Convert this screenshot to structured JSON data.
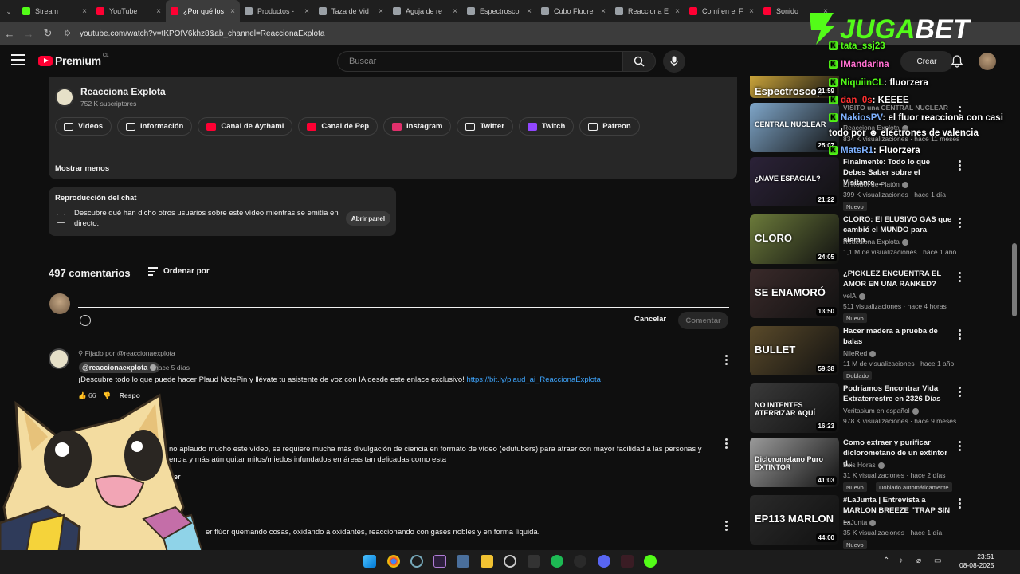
{
  "browser": {
    "tabs": [
      {
        "title": "Stream",
        "color": "#53fc18",
        "active": false
      },
      {
        "title": "YouTube",
        "color": "#ff0033",
        "active": false
      },
      {
        "title": "¿Por qué los",
        "color": "#ff0033",
        "active": true
      },
      {
        "title": "Productos -",
        "color": "#9aa0a6",
        "active": false
      },
      {
        "title": "Taza de Vid",
        "color": "#9aa0a6",
        "active": false
      },
      {
        "title": "Aguja de re",
        "color": "#9aa0a6",
        "active": false
      },
      {
        "title": "Espectrosco",
        "color": "#9aa0a6",
        "active": false
      },
      {
        "title": "Cubo Fluore",
        "color": "#9aa0a6",
        "active": false
      },
      {
        "title": "Reacciona E",
        "color": "#9aa0a6",
        "active": false
      },
      {
        "title": "Comí en el F",
        "color": "#ff0033",
        "active": false
      },
      {
        "title": "Sonido",
        "color": "#ff0033",
        "active": false
      }
    ],
    "url": "youtube.com/watch?v=tKPOfV6khz8&ab_channel=ReaccionaExplota"
  },
  "header": {
    "logo_text": "Premium",
    "logo_country": "CL",
    "search_placeholder": "Buscar",
    "create_label": "Crear"
  },
  "channel": {
    "name": "Reacciona Explota",
    "subscribers": "752 K suscriptores",
    "links": [
      {
        "label": "Videos",
        "icon": "video-icon",
        "color": "#f1f1f1"
      },
      {
        "label": "Información",
        "icon": "info-icon",
        "color": "#f1f1f1"
      },
      {
        "label": "Canal de Aythami",
        "icon": "youtube-icon",
        "color": "#ff0033"
      },
      {
        "label": "Canal de Pep",
        "icon": "youtube-icon",
        "color": "#ff0033"
      },
      {
        "label": "Instagram",
        "icon": "instagram-icon",
        "color": "#e1306c"
      },
      {
        "label": "Twitter",
        "icon": "x-icon",
        "color": "#f1f1f1"
      },
      {
        "label": "Twitch",
        "icon": "twitch-icon",
        "color": "#9146ff"
      },
      {
        "label": "Patreon",
        "icon": "patreon-icon",
        "color": "#f1f1f1"
      }
    ],
    "show_less": "Mostrar menos"
  },
  "chat_replay": {
    "title": "Reproducción del chat",
    "description": "Descubre qué han dicho otros usuarios sobre este vídeo mientras se emitía en directo.",
    "button": "Abrir panel"
  },
  "comments": {
    "count": "497 comentarios",
    "sort_label": "Ordenar por",
    "cancel": "Cancelar",
    "submit": "Comentar",
    "pinned": {
      "pinned_by": "Fijado por @reaccionaexplota",
      "author": "@reaccionaexplota",
      "time": "hace 5 días",
      "text": "¡Descubre todo lo que puede hacer Plaud NotePin y llévate tu asistente de voz con IA desde este enlace exclusivo! ",
      "link": "https://bit.ly/plaud_ai_ReaccionaExplota",
      "likes": "66",
      "reply": "Respo"
    },
    "second": {
      "text_line1": "no aplaudo mucho este vídeo, se requiere mucha más divulgación de ciencia en formato de vídeo (edutubers) para atraer con mayor facilidad a las personas y",
      "text_line2": "encia y más aún quitar mitos/miedos infundados en áreas tan delicadas como esta",
      "reply": "er"
    },
    "third": {
      "text": "er flúor quemando cosas, oxidando a oxidantes, reaccionando con gases nobles y en forma líquida."
    }
  },
  "sidebar": {
    "videos": [
      {
        "title": "",
        "channel": "",
        "stats": "",
        "duration": "21:59",
        "thumb_text": "Espectroscop",
        "thumb_color": "#c9a33a",
        "badges": []
      },
      {
        "title": "VISITO una CENTRAL NUCLEAR",
        "channel": "Reacciona Explota",
        "stats": "834 K visualizaciones · hace 11 meses",
        "duration": "25:07",
        "thumb_text": "CENTRAL NUCLEAR",
        "thumb_color": "#7fa6c9",
        "badges": []
      },
      {
        "title": "Finalmente: Todo lo que Debes Saber sobre el Visitante ...",
        "channel": "El Robot de Platón",
        "stats": "399 K visualizaciones · hace 1 día",
        "duration": "21:22",
        "thumb_text": "¿NAVE ESPACIAL?",
        "thumb_color": "#2b2238",
        "badges": [
          "Nuevo"
        ]
      },
      {
        "title": "CLORO: El ELUSIVO GAS que cambió el MUNDO para siemp...",
        "channel": "Reacciona Explota",
        "stats": "1,1 M de visualizaciones · hace 1 año",
        "duration": "24:05",
        "thumb_text": "CLORO",
        "thumb_color": "#6b7a3a",
        "badges": []
      },
      {
        "title": "¿PICKLEZ ENCUENTRA EL AMOR EN UNA RANKED?",
        "channel": "velA",
        "stats": "511 visualizaciones · hace 4 horas",
        "duration": "13:50",
        "thumb_text": "SE ENAMORÓ",
        "thumb_color": "#3a2a2a",
        "badges": [
          "Nuevo"
        ]
      },
      {
        "title": "Hacer madera a prueba de balas",
        "channel": "NileRed",
        "stats": "11 M de visualizaciones · hace 1 año",
        "duration": "59:38",
        "thumb_text": "BULLET",
        "thumb_color": "#5a4a2a",
        "badges": [
          "Doblado"
        ]
      },
      {
        "title": "Podríamos Encontrar Vida Extraterrestre en 2326 Días",
        "channel": "Veritasium en español",
        "stats": "978 K visualizaciones · hace 9 meses",
        "duration": "16:23",
        "thumb_text": "NO INTENTES ATERRIZAR AQUÍ",
        "thumb_color": "#3a3a3a",
        "badges": []
      },
      {
        "title": "Como extraer y purificar diclorometano de un extintor d...",
        "channel": "Luis Horas",
        "stats": "31 K visualizaciones · hace 2 días",
        "duration": "41:03",
        "thumb_text": "Diclorometano Puro EXTINTOR",
        "thumb_color": "#9a9a9a",
        "badges": [
          "Nuevo",
          "Doblado automáticamente"
        ]
      },
      {
        "title": "#LaJunta | Entrevista a MARLON BREEZE \"TRAP SIN ...",
        "channel": "LaJunta",
        "stats": "35 K visualizaciones · hace 1 día",
        "duration": "44:00",
        "thumb_text": "EP113 MARLON",
        "thumb_color": "#2a2a2a",
        "badges": [
          "Nuevo"
        ]
      }
    ]
  },
  "stream_overlay": {
    "sponsor": "JUGABET",
    "messages": [
      {
        "user": "tata_ssj23",
        "text": "",
        "color": "#53fc18"
      },
      {
        "user": "IMandarina",
        "text": "",
        "color": "#ff6fd0"
      },
      {
        "user": "NiquiinCL",
        "text": ": fluorzera",
        "color": "#53fc18"
      },
      {
        "user": "dan_0s",
        "text": ": KEEEE",
        "color": "#ff3030"
      },
      {
        "user": "NakiosPV",
        "text": ": el fluor reacciona con casi",
        "color": "#7fb2ff"
      },
      {
        "user": "",
        "text": "todo por ☻ electrones de valencia",
        "color": "#ffffff"
      },
      {
        "user": "MatsR1",
        "text": ": Fluorzera",
        "color": "#7fb2ff"
      }
    ]
  },
  "taskbar": {
    "time": "23:51",
    "date": "08-08-2025"
  }
}
